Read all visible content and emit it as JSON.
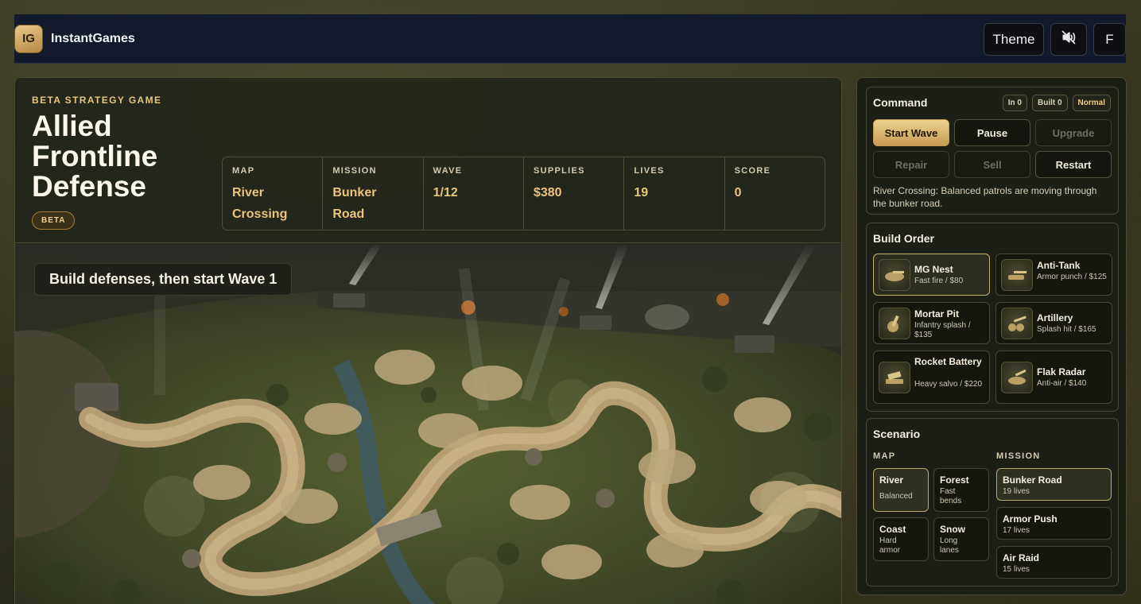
{
  "nav": {
    "logo": "IG",
    "brand": "InstantGames",
    "theme_label": "Theme",
    "sound_icon": "speaker-muted-icon",
    "fullscreen_label": "F"
  },
  "hero": {
    "eyebrow": "BETA STRATEGY GAME",
    "title": "Allied Frontline Defense",
    "badge": "BETA",
    "stats": [
      {
        "label": "MAP",
        "value": "River Crossing"
      },
      {
        "label": "MISSION",
        "value": "Bunker Road"
      },
      {
        "label": "WAVE",
        "value": "1/12"
      },
      {
        "label": "SUPPLIES",
        "value": "$380"
      },
      {
        "label": "LIVES",
        "value": "19"
      },
      {
        "label": "SCORE",
        "value": "0"
      }
    ]
  },
  "map": {
    "toast": "Build defenses, then start Wave 1"
  },
  "command": {
    "title": "Command",
    "chips": {
      "in": "In 0",
      "built": "Built 0",
      "difficulty": "Normal"
    },
    "buttons": {
      "start_wave": "Start Wave",
      "pause": "Pause",
      "upgrade": "Upgrade",
      "repair": "Repair",
      "sell": "Sell",
      "restart": "Restart"
    },
    "note": "River Crossing: Balanced patrols are moving through the bunker road."
  },
  "build_order": {
    "title": "Build Order",
    "items": [
      {
        "name": "MG Nest",
        "desc": "Fast fire / $80",
        "icon": "mg-nest-icon"
      },
      {
        "name": "Anti-Tank",
        "desc": "Armor punch / $125",
        "icon": "anti-tank-icon"
      },
      {
        "name": "Mortar Pit",
        "desc": "Infantry splash / $135",
        "icon": "mortar-icon"
      },
      {
        "name": "Artillery",
        "desc": "Splash hit / $165",
        "icon": "artillery-icon"
      },
      {
        "name": "Rocket Battery",
        "desc": "Heavy salvo / $220",
        "icon": "rocket-battery-icon"
      },
      {
        "name": "Flak Radar",
        "desc": "Anti-air / $140",
        "icon": "flak-radar-icon"
      }
    ]
  },
  "scenario": {
    "title": "Scenario",
    "map_label": "MAP",
    "mission_label": "MISSION",
    "maps": [
      {
        "name": "River",
        "sub": "Balanced"
      },
      {
        "name": "Forest",
        "sub": "Fast bends"
      },
      {
        "name": "Coast",
        "sub": "Hard armor"
      },
      {
        "name": "Snow",
        "sub": "Long lanes"
      }
    ],
    "missions": [
      {
        "name": "Bunker Road",
        "sub": "19 lives"
      },
      {
        "name": "Armor Push",
        "sub": "17 lives"
      },
      {
        "name": "Air Raid",
        "sub": "15 lives"
      }
    ]
  }
}
